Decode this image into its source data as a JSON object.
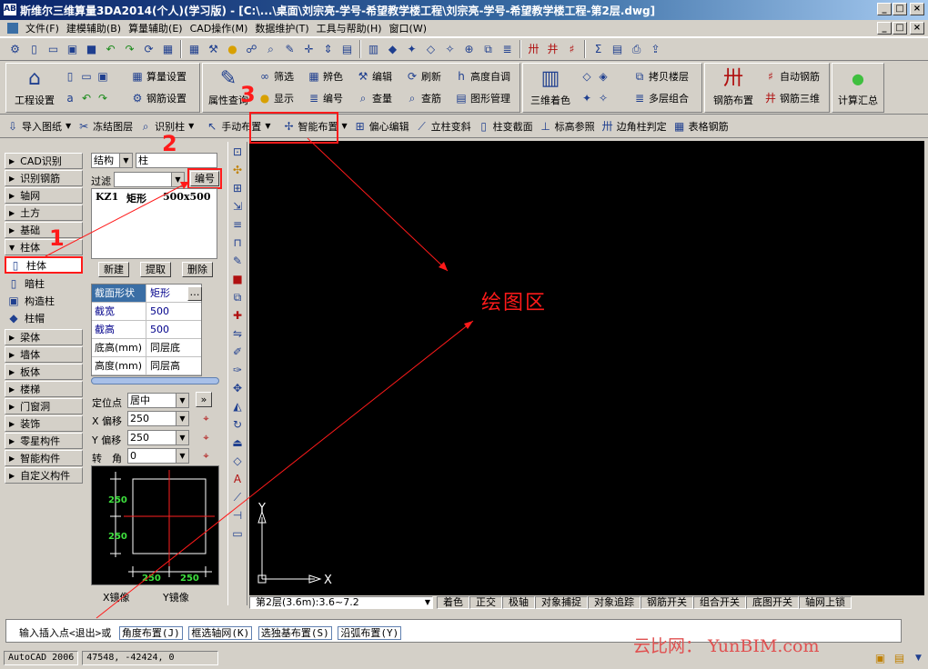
{
  "window": {
    "title": "斯维尔三维算量3DA2014(个人)(学习版) - [C:\\...\\桌面\\刘宗亮-学号-希望教学楼工程\\刘宗亮-学号-希望教学楼工程-第2层.dwg]",
    "logo_text": "AB",
    "buttons": [
      "_",
      "□",
      "×"
    ],
    "mdi_buttons": [
      "_",
      "□",
      "×"
    ]
  },
  "menu": [
    "文件(F)",
    "建模辅助(B)",
    "算量辅助(E)",
    "CAD操作(M)",
    "数据维护(T)",
    "工具与帮助(H)",
    "窗口(W)"
  ],
  "ribbon": {
    "project_settings": "工程设置",
    "quantity_settings": "算量设置",
    "rebar_settings": "钢筋设置",
    "property_query": "属性查询",
    "filter": "筛选",
    "distinguish_color": "辨色",
    "edit": "编辑",
    "refresh": "刷新",
    "auto_height": "高度自调",
    "show": "显示",
    "number": "编号",
    "check_quantity": "查量",
    "check_rebar": "查筋",
    "graphic_manage": "图形管理",
    "color_3d": "三维着色",
    "copy_floor": "拷贝楼层",
    "multi_floor": "多层组合",
    "rebar_layout": "钢筋布置",
    "auto_rebar": "自动钢筋",
    "rebar_3d": "钢筋三维",
    "calc_summary": "计算汇总"
  },
  "toolbar3": [
    "导入图纸",
    "冻结图层",
    "识别柱",
    "手动布置",
    "智能布置",
    "偏心编辑",
    "立柱变斜",
    "柱变截面",
    "标高参照",
    "边角柱判定",
    "表格钢筋"
  ],
  "categories_top": [
    "CAD识别",
    "识别钢筋",
    "轴网",
    "土方",
    "基础",
    "柱体"
  ],
  "column_items": [
    "柱体",
    "暗柱",
    "构造柱",
    "柱帽"
  ],
  "categories_bottom": [
    "梁体",
    "墙体",
    "板体",
    "楼梯",
    "门窗洞",
    "装饰",
    "零星构件",
    "智能构件",
    "自定义构件"
  ],
  "mid": {
    "struct_type": "结构",
    "struct_sub": "柱",
    "filter_label": "过滤",
    "number_button": "编号",
    "list_row": {
      "code": "KZ1",
      "shape": "矩形",
      "size": "500x500"
    },
    "buttons": [
      "新建",
      "提取",
      "删除"
    ],
    "props": [
      {
        "key": "截面形状",
        "value": "矩形"
      },
      {
        "key": "截宽",
        "value": "500"
      },
      {
        "key": "截高",
        "value": "500"
      },
      {
        "key": "底高(mm)",
        "value": "同层底"
      },
      {
        "key": "高度(mm)",
        "value": "同层高"
      }
    ],
    "locate_label": "定位点",
    "locate_value": "居中",
    "x_offset_label": "X 偏移",
    "x_offset_value": "250",
    "y_offset_label": "Y 偏移",
    "y_offset_value": "250",
    "rotate_label": "转　角",
    "rotate_value": "0",
    "preview_dims": [
      "250",
      "250",
      "250",
      "250"
    ],
    "mirror_x": "X镜像",
    "mirror_y": "Y镜像"
  },
  "canvas": {
    "label": "绘图区",
    "axis_x": "X",
    "axis_y": "Y",
    "annotations": [
      "1",
      "2",
      "3"
    ]
  },
  "status": {
    "floor": "第2层(3.6m):3.6~7.2",
    "toggles": [
      "着色",
      "正交",
      "极轴",
      "对象捕捉",
      "对象追踪",
      "钢筋开关",
      "组合开关",
      "底图开关",
      "轴网上锁"
    ]
  },
  "command": {
    "prompt": "输入插入点<退出>或",
    "options": [
      "角度布置(J)",
      "框选轴网(K)",
      "选独基布置(S)",
      "沿弧布置(Y)"
    ]
  },
  "bottom": {
    "version": "AutoCAD 2006",
    "coords": "47548,  -42424, 0",
    "watermark": "云比网： YunBIM.com"
  },
  "colors": {
    "annotation_red": "#ff1a1a",
    "canvas_bg": "#000000",
    "title_blue": "#0a246a"
  }
}
